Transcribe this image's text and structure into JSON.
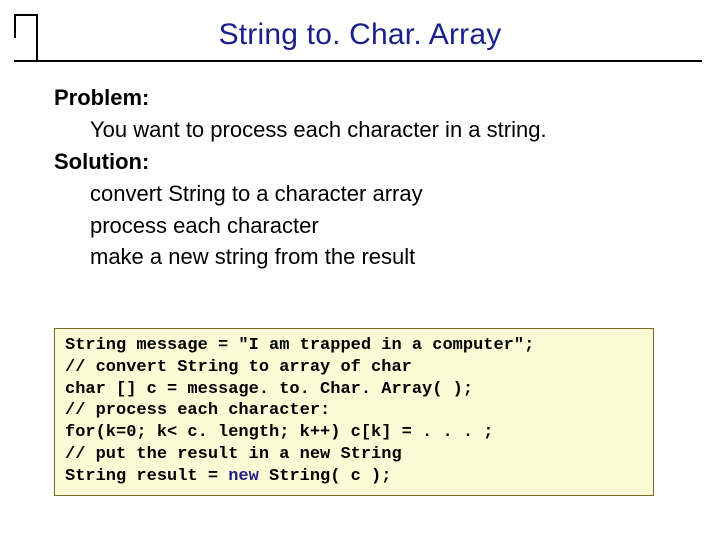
{
  "title": "String to. Char. Array",
  "body": {
    "problem_label": "Problem:",
    "problem_text": "You want to process each character in a string.",
    "solution_label": "Solution:",
    "solution_line1": "convert String to a character array",
    "solution_line2": "process each character",
    "solution_line3": "make a new string from the result"
  },
  "code": {
    "l1": "String message = \"I am trapped in a computer\";",
    "l2": "// convert String to array of char",
    "l3": "char [] c = message. to. Char. Array( );",
    "l4": "// process each character:",
    "l5": "for(k=0; k< c. length; k++) c[k] = . . . ;",
    "l6": "// put the result in a new String",
    "l7_a": "String result = ",
    "l7_new": "new",
    "l7_b": " String( c );"
  }
}
